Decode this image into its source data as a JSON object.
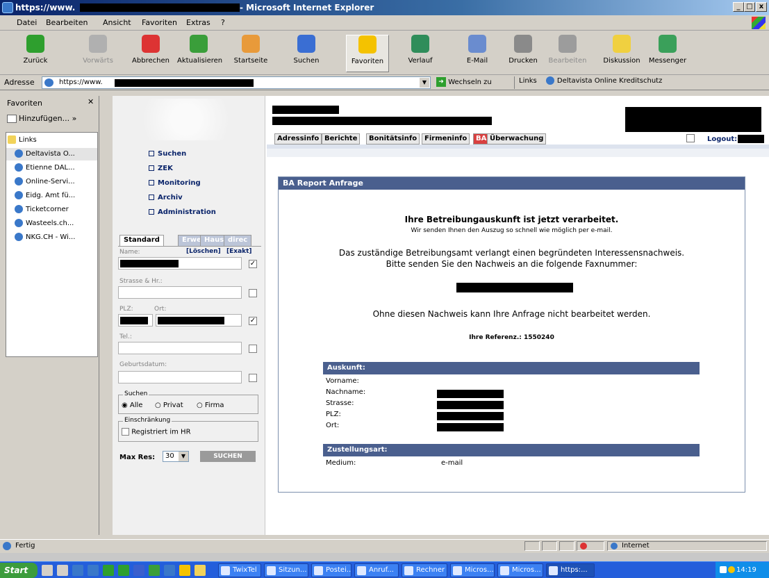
{
  "window": {
    "title_prefix": "https://www.",
    "title_suffix": "- Microsoft Internet Explorer",
    "min": "_",
    "max": "□",
    "close": "x"
  },
  "menu": [
    "Datei",
    "Bearbeiten",
    "Ansicht",
    "Favoriten",
    "Extras",
    "?"
  ],
  "toolbar": [
    {
      "label": "Zurück",
      "icon": "back-icon",
      "color": "#2e9f2e"
    },
    {
      "label": "Vorwärts",
      "icon": "forward-icon",
      "color": "#b0b0b0"
    },
    {
      "label": "Abbrechen",
      "icon": "stop-icon",
      "color": "#d33"
    },
    {
      "label": "Aktualisieren",
      "icon": "refresh-icon",
      "color": "#3a9e3a"
    },
    {
      "label": "Startseite",
      "icon": "home-icon",
      "color": "#e89a3a"
    },
    {
      "label": "Suchen",
      "icon": "search-icon",
      "color": "#3a6ed3"
    },
    {
      "label": "Favoriten",
      "icon": "favorites-icon",
      "color": "#f4c200"
    },
    {
      "label": "Verlauf",
      "icon": "history-icon",
      "color": "#2f8d5a"
    },
    {
      "label": "E-Mail",
      "icon": "mail-icon",
      "color": "#6a8ccf"
    },
    {
      "label": "Drucken",
      "icon": "print-icon",
      "color": "#8a8a8a"
    },
    {
      "label": "Bearbeiten",
      "icon": "edit-icon",
      "color": "#9c9c9c"
    },
    {
      "label": "Diskussion",
      "icon": "discussion-icon",
      "color": "#f0d040"
    },
    {
      "label": "Messenger",
      "icon": "messenger-icon",
      "color": "#3aa05a"
    }
  ],
  "address": {
    "label": "Adresse",
    "value": "https://www.",
    "go": "Wechseln zu",
    "links": "Links",
    "link1": "Deltavista Online Kreditschutz"
  },
  "favorites": {
    "title": "Favoriten",
    "add": "Hinzufügen...",
    "folder": "Links",
    "items": [
      "Deltavista O...",
      "Etienne DAL...",
      "Online-Servi...",
      "Eidg. Amt fü...",
      "Ticketcorner",
      "Wasteels.ch...",
      "NKG.CH - Wi..."
    ]
  },
  "nav": [
    "Suchen",
    "ZEK",
    "Monitoring",
    "Archiv",
    "Administration"
  ],
  "form": {
    "tabs": [
      "Standard",
      "Erwe",
      "Haus",
      "direc"
    ],
    "name": "Name:",
    "clear": "[Löschen]",
    "exact": "[Exakt]",
    "street": "Strasse & Hr.:",
    "plz": "PLZ:",
    "ort": "Ort:",
    "tel": "Tel.:",
    "dob": "Geburtsdatum:",
    "search_group": "Suchen",
    "opt_all": "Alle",
    "opt_private": "Privat",
    "opt_company": "Firma",
    "restrict_group": "Einschränkung",
    "restrict": "Registriert im HR",
    "maxres": "Max Res:",
    "maxres_val": "30",
    "submit": "SUCHEN"
  },
  "main_tabs": [
    "Adressinfo",
    "Berichte",
    "Bonitätsinfo",
    "Firmeninfo",
    "BA",
    "Überwachung"
  ],
  "logout": "Logout:",
  "report": {
    "title": "BA Report Anfrage",
    "h1": "Ihre Betreibungauskunft ist jetzt verarbeitet.",
    "h2": "Wir senden Ihnen den Auszug so schnell wie möglich per e-mail.",
    "p1": "Das zuständige Betreibungsamt verlangt einen begründeten Interessensnachweis.",
    "p2": "Bitte senden Sie den Nachweis an die folgende Faxnummer:",
    "p3": "Ohne diesen Nachweis kann Ihre Anfrage nicht bearbeitet werden.",
    "ref_label": "Ihre Referenz.:",
    "ref": "1550240",
    "sec1": "Auskunft:",
    "f1": "Vorname:",
    "f2": "Nachname:",
    "f3": "Strasse:",
    "f4": "PLZ:",
    "f5": "Ort:",
    "sec2": "Zustellungsart:",
    "medium_label": "Medium:",
    "medium": "e-mail"
  },
  "status": {
    "text": "Fertig",
    "zone": "Internet"
  },
  "taskbar": {
    "start": "Start",
    "tasks": [
      "TwixTel",
      "Sitzun...",
      "Postei...",
      "Anruf...",
      "Rechner",
      "Micros...",
      "Micros...",
      "https:..."
    ],
    "clock": "14:19"
  }
}
